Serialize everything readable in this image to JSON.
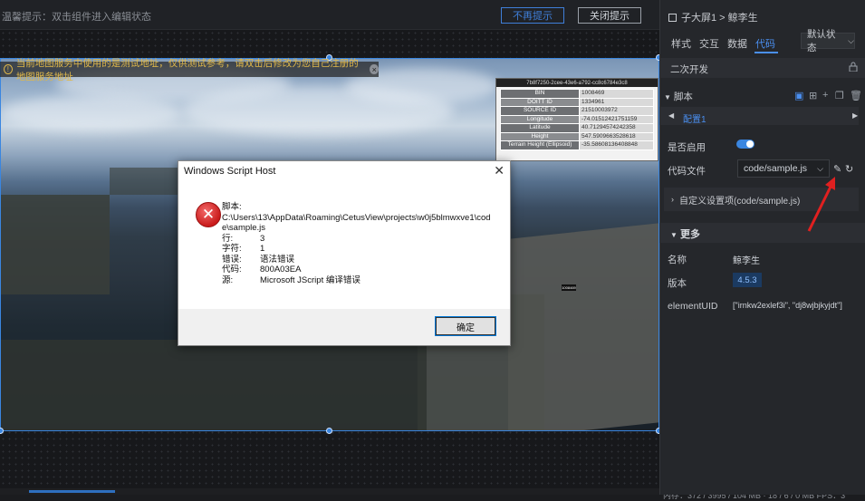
{
  "topbar": {
    "tip": "温馨提示：双击组件进入编辑状态",
    "no_remind_label": "不再提示",
    "close_tip_label": "关闭提示"
  },
  "map": {
    "warning": "当前地图服务中使用的是测试地址，仅供测试参考，请双击后修改为您自己注册的地图服务地址",
    "info_header": "7b8f7250-2cee-43e6-a792-cc8c6784e3c8",
    "info_rows": [
      {
        "k": "BIN",
        "v": "1008469"
      },
      {
        "k": "DOITT ID",
        "v": "1334961"
      },
      {
        "k": "SOURCE ID",
        "v": "21510003972"
      },
      {
        "k": "Longitude",
        "v": "-74.01512421751159"
      },
      {
        "k": "Latitude",
        "v": "40.71294574242358"
      },
      {
        "k": "Height",
        "v": "547.5909663528618"
      },
      {
        "k": "Terrain Height (Ellipsoid)",
        "v": "-35.58608136408848"
      }
    ],
    "marker_label": "1008469"
  },
  "dialog": {
    "title": "Windows Script Host",
    "script_label": "脚本:",
    "script_path_1": "C:\\Users\\13\\AppData\\Roaming\\CetusView\\projects\\w0j5blmwxve1\\cod",
    "script_path_2": "e\\sample.js",
    "rows": [
      {
        "k": "行:",
        "v": "3"
      },
      {
        "k": "字符:",
        "v": "1"
      },
      {
        "k": "错误:",
        "v": "语法错误"
      },
      {
        "k": "代码:",
        "v": "800A03EA"
      },
      {
        "k": "源:",
        "v": "Microsoft JScript 编译错误"
      }
    ],
    "ok_label": "确定"
  },
  "status_text": "内存：372 / 3995 / 104 MB · 18 / 6 / 0 MB    FPS：3",
  "panel": {
    "breadcrumb": "子大屏1 > 鲸李生",
    "tabs": [
      "样式",
      "交互",
      "数据",
      "代码"
    ],
    "state_select": "默认状态",
    "dev_section": "二次开发",
    "script_label": "脚本",
    "config_label": "配置1",
    "enable_label": "是否启用",
    "codefile_label": "代码文件",
    "codefile_value": "code/sample.js",
    "custom_label": "自定义设置项(code/sample.js)",
    "more_label": "更多",
    "props": [
      {
        "k": "名称",
        "v": "鲸李生"
      },
      {
        "k": "版本",
        "v": "4.5.3"
      },
      {
        "k": "elementUID",
        "v": "[\"irnkw2exlef3i\", \"dj8wjbjkyjdt\"]"
      }
    ]
  },
  "colors": {
    "accent": "#3a86e0",
    "error_red": "#d81e1e",
    "warning_text": "#e0b84a"
  }
}
